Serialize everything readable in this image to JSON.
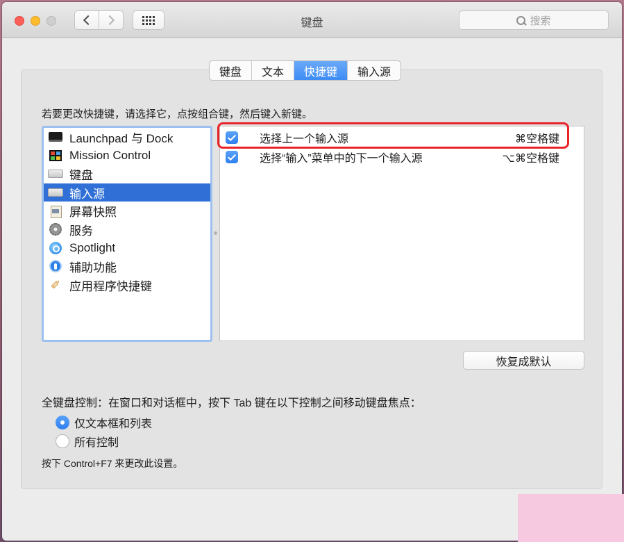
{
  "window": {
    "title": "键盘",
    "search_placeholder": "搜索"
  },
  "tabs": [
    {
      "label": "键盘",
      "active": false
    },
    {
      "label": "文本",
      "active": false
    },
    {
      "label": "快捷键",
      "active": true
    },
    {
      "label": "输入源",
      "active": false
    }
  ],
  "instruction": "若要更改快捷键，请选择它，点按组合键，然后键入新键。",
  "categories": [
    {
      "label": "Launchpad 与 Dock",
      "icon": "launchpad-dock-icon",
      "selected": false
    },
    {
      "label": "Mission Control",
      "icon": "mission-control-icon",
      "selected": false
    },
    {
      "label": "键盘",
      "icon": "keyboard-icon",
      "selected": false
    },
    {
      "label": "输入源",
      "icon": "input-source-icon",
      "selected": true
    },
    {
      "label": "屏幕快照",
      "icon": "screenshot-icon",
      "selected": false
    },
    {
      "label": "服务",
      "icon": "services-gear-icon",
      "selected": false
    },
    {
      "label": "Spotlight",
      "icon": "spotlight-icon",
      "selected": false
    },
    {
      "label": "辅助功能",
      "icon": "accessibility-icon",
      "selected": false
    },
    {
      "label": "应用程序快捷键",
      "icon": "app-shortcuts-icon",
      "selected": false
    }
  ],
  "shortcuts": [
    {
      "enabled": true,
      "label": "选择上一个输入源",
      "keys": "⌘空格键"
    },
    {
      "enabled": true,
      "label": "选择“输入”菜单中的下一个输入源",
      "keys": "⌥⌘空格键"
    }
  ],
  "reset_button": "恢复成默认",
  "full_keyboard_access": {
    "label": "全键盘控制：在窗口和对话框中，按下 Tab 键在以下控制之间移动键盘焦点：",
    "options": [
      {
        "label": "仅文本框和列表",
        "selected": true
      },
      {
        "label": "所有控制",
        "selected": false
      }
    ],
    "hint": "按下 Control+F7 来更改此设置。"
  },
  "colors": {
    "accent": "#2f6fd6",
    "highlight_box": "#e8242a"
  }
}
